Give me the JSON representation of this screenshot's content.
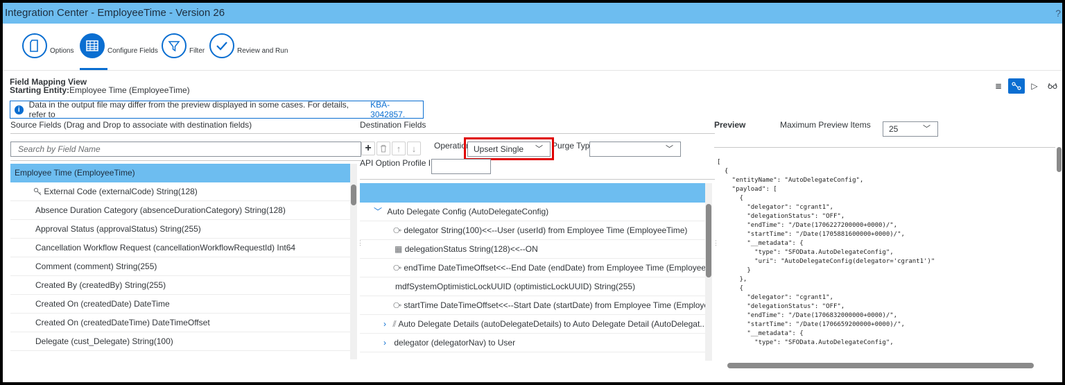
{
  "window": {
    "title": "Integration Center - EmployeeTime - Version 26",
    "help_icon": "?"
  },
  "wizard": {
    "steps": [
      {
        "label": "Options",
        "icon": "document-icon"
      },
      {
        "label": "Configure Fields",
        "icon": "table-icon"
      },
      {
        "label": "Filter",
        "icon": "filter-icon"
      },
      {
        "label": "Review and Run",
        "icon": "checkmark-icon"
      }
    ]
  },
  "header": {
    "view_title": "Field Mapping View",
    "starting_entity_label": "Starting Entity:",
    "starting_entity_value": "Employee Time (EmployeeTime)"
  },
  "info": {
    "message": "Data in the output file may differ from the preview displayed in some cases. For details, refer to",
    "link": "KBA-3042857."
  },
  "source": {
    "title": "Source Fields (Drag and Drop to associate with destination fields)",
    "search_placeholder": "Search by Field Name",
    "root": "Employee Time (EmployeeTime)",
    "fields": [
      "External Code (externalCode) String(128)",
      "Absence Duration Category (absenceDurationCategory) String(128)",
      "Approval Status (approvalStatus) String(255)",
      "Cancellation Workflow Request (cancellationWorkflowRequestId) Int64",
      "Comment (comment) String(255)",
      "Created By (createdBy) String(255)",
      "Created On (createdDate) DateTime",
      "Created On (createdDateTime) DateTimeOffset",
      "Delegate (cust_Delegate) String(100)"
    ]
  },
  "destination": {
    "title": "Destination Fields",
    "operation_label": "Operation",
    "operation_value": "Upsert Single",
    "purge_label": "Purge Type",
    "purge_value": "",
    "api_label": "API Option Profile ID",
    "api_value": "",
    "root": "Auto Delegate Config (AutoDelegateConfig)",
    "fields": [
      "delegator String(100)<<--User (userId) from Employee Time (EmployeeTime)",
      "delegationStatus String(128)<<--ON",
      "endTime DateTimeOffset<<--End Date (endDate) from Employee Time (Employee...",
      "mdfSystemOptimisticLockUUID (optimisticLockUUID) String(255)",
      "startTime DateTimeOffset<<--Start Date (startDate) from Employee Time (Employe...",
      "Auto Delegate Details (autoDelegateDetails) to Auto Delegate Detail (AutoDelegat...",
      "delegator (delegatorNav) to User"
    ]
  },
  "preview": {
    "title": "Preview",
    "max_label": "Maximum Preview Items",
    "max_value": "25",
    "json_lines": [
      "[",
      "  {",
      "    \"entityName\": \"AutoDelegateConfig\",",
      "    \"payload\": [",
      "      {",
      "        \"delegator\": \"cgrant1\",",
      "        \"delegationStatus\": \"OFF\",",
      "        \"endTime\": \"/Date(1706227200000+0000)/\",",
      "        \"startTime\": \"/Date(1705881600000+0000)/\",",
      "        \"__metadata\": {",
      "          \"type\": \"SFOData.AutoDelegateConfig\",",
      "          \"uri\": \"AutoDelegateConfig(delegator='cgrant1')\"",
      "        }",
      "      },",
      "      {",
      "        \"delegator\": \"cgrant1\",",
      "        \"delegationStatus\": \"OFF\",",
      "        \"endTime\": \"/Date(1706832000000+0000)/\",",
      "        \"startTime\": \"/Date(1706659200000+0000)/\",",
      "        \"__metadata\": {",
      "          \"type\": \"SFOData.AutoDelegateConfig\","
    ]
  },
  "colors": {
    "accent": "#0a6ed1",
    "header_bar": "#6dbdf0",
    "highlight": "#e00000"
  }
}
